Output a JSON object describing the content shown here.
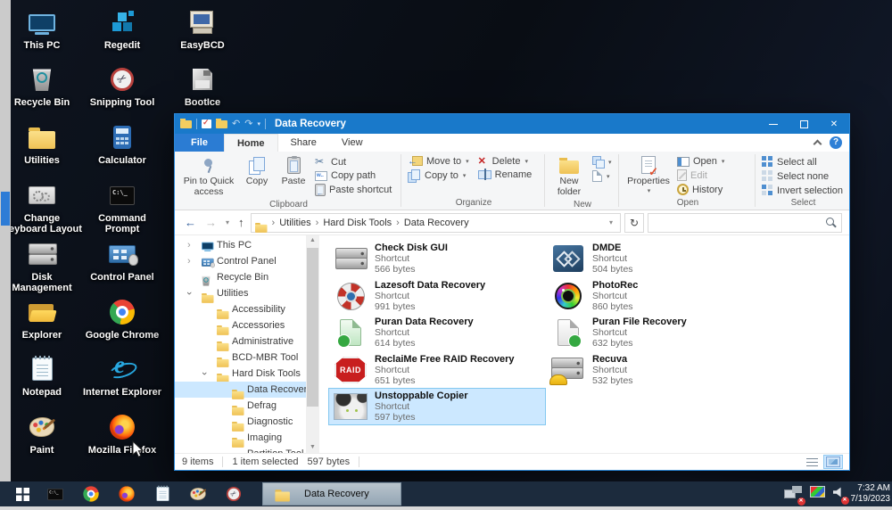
{
  "desktop": {
    "icons": [
      {
        "label": "This PC",
        "icon": "pc",
        "col": 0,
        "row": 0
      },
      {
        "label": "Regedit",
        "icon": "regedit",
        "col": 1,
        "row": 0
      },
      {
        "label": "EasyBCD",
        "icon": "easybcd",
        "col": 2,
        "row": 0
      },
      {
        "label": "Recycle Bin",
        "icon": "bin",
        "col": 0,
        "row": 1
      },
      {
        "label": "Snipping Tool",
        "icon": "snip",
        "col": 1,
        "row": 1
      },
      {
        "label": "BootIce",
        "icon": "bootice",
        "col": 2,
        "row": 1
      },
      {
        "label": "Utilities",
        "icon": "folder",
        "col": 0,
        "row": 2
      },
      {
        "label": "Calculator",
        "icon": "calc",
        "col": 1,
        "row": 2
      },
      {
        "label": "Change Keyboard Layout",
        "icon": "kbd",
        "col": 0,
        "row": 3
      },
      {
        "label": "Command Prompt",
        "icon": "cmd",
        "col": 1,
        "row": 3
      },
      {
        "label": "Disk Management",
        "icon": "hdd",
        "col": 0,
        "row": 4
      },
      {
        "label": "Control Panel",
        "icon": "cpanel",
        "col": 1,
        "row": 4
      },
      {
        "label": "Explorer",
        "icon": "explorer",
        "col": 0,
        "row": 5
      },
      {
        "label": "Google Chrome",
        "icon": "chrome",
        "col": 1,
        "row": 5
      },
      {
        "label": "Notepad",
        "icon": "notepad",
        "col": 0,
        "row": 6
      },
      {
        "label": "Internet Explorer",
        "icon": "ie",
        "col": 1,
        "row": 6
      },
      {
        "label": "Paint",
        "icon": "paint",
        "col": 0,
        "row": 7
      },
      {
        "label": "Mozilla Firefox",
        "icon": "firefox",
        "col": 1,
        "row": 7
      }
    ]
  },
  "window": {
    "title": "Data Recovery",
    "tabs": {
      "file": "File",
      "home": "Home",
      "share": "Share",
      "view": "View"
    },
    "ribbon": {
      "groups": {
        "clipboard": "Clipboard",
        "organize": "Organize",
        "new_group": "New",
        "open": "Open",
        "select": "Select"
      },
      "pin": "Pin to Quick access",
      "copy": "Copy",
      "paste": "Paste",
      "cut": "Cut",
      "copy_path": "Copy path",
      "paste_shortcut": "Paste shortcut",
      "move_to": "Move to",
      "copy_to": "Copy to",
      "delete": "Delete",
      "rename": "Rename",
      "new_folder": "New folder",
      "properties": "Properties",
      "open_item": "Open",
      "edit": "Edit",
      "history": "History",
      "select_all": "Select all",
      "select_none": "Select none",
      "invert_selection": "Invert selection"
    },
    "address": {
      "crumbs": [
        "Utilities",
        "Hard Disk Tools",
        "Data Recovery"
      ],
      "search_value": ""
    },
    "tree": {
      "items": [
        {
          "label": "This PC",
          "depth": 0,
          "icon": "pc",
          "expander": "collapsed",
          "selected": false
        },
        {
          "label": "Control Panel",
          "depth": 0,
          "icon": "cpanel",
          "expander": "collapsed",
          "selected": false
        },
        {
          "label": "Recycle Bin",
          "depth": 0,
          "icon": "bin",
          "expander": "none",
          "selected": false
        },
        {
          "label": "Utilities",
          "depth": 0,
          "icon": "folder",
          "expander": "expanded",
          "selected": false
        },
        {
          "label": "Accessibility",
          "depth": 1,
          "icon": "folder",
          "expander": "none",
          "selected": false
        },
        {
          "label": "Accessories",
          "depth": 1,
          "icon": "folder",
          "expander": "none",
          "selected": false
        },
        {
          "label": "Administrative",
          "depth": 1,
          "icon": "folder",
          "expander": "none",
          "selected": false
        },
        {
          "label": "BCD-MBR Tool",
          "depth": 1,
          "icon": "folder",
          "expander": "none",
          "selected": false
        },
        {
          "label": "Hard Disk Tools",
          "depth": 1,
          "icon": "folder",
          "expander": "expanded",
          "selected": false
        },
        {
          "label": "Data Recovery",
          "depth": 2,
          "icon": "folder",
          "expander": "none",
          "selected": true
        },
        {
          "label": "Defrag",
          "depth": 2,
          "icon": "folder",
          "expander": "none",
          "selected": false
        },
        {
          "label": "Diagnostic",
          "depth": 2,
          "icon": "folder",
          "expander": "none",
          "selected": false
        },
        {
          "label": "Imaging",
          "depth": 2,
          "icon": "folder",
          "expander": "none",
          "selected": false
        },
        {
          "label": "Partition Tool",
          "depth": 2,
          "icon": "folder",
          "expander": "none",
          "selected": false
        }
      ]
    },
    "files": {
      "columns": [
        [
          {
            "name": "Check Disk GUI",
            "type": "Shortcut",
            "size": "566 bytes",
            "icon": "chk",
            "selected": false
          },
          {
            "name": "Lazesoft Data Recovery",
            "type": "Shortcut",
            "size": "991 bytes",
            "icon": "laze",
            "selected": false
          },
          {
            "name": "Puran Data Recovery",
            "type": "Shortcut",
            "size": "614 bytes",
            "icon": "pdoc",
            "selected": false
          },
          {
            "name": "ReclaiMe Free RAID Recovery",
            "type": "Shortcut",
            "size": "651 bytes",
            "icon": "raid",
            "icon_text": "RAID",
            "selected": false
          },
          {
            "name": "Unstoppable Copier",
            "type": "Shortcut",
            "size": "597 bytes",
            "icon": "cat",
            "selected": true
          }
        ],
        [
          {
            "name": "DMDE",
            "type": "Shortcut",
            "size": "504 bytes",
            "icon": "dmde",
            "selected": false
          },
          {
            "name": "PhotoRec",
            "type": "Shortcut",
            "size": "860 bytes",
            "icon": "photorec",
            "selected": false
          },
          {
            "name": "Puran File Recovery",
            "type": "Shortcut",
            "size": "632 bytes",
            "icon": "pfile",
            "selected": false
          },
          {
            "name": "Recuva",
            "type": "Shortcut",
            "size": "532 bytes",
            "icon": "recuva",
            "selected": false
          }
        ]
      ]
    },
    "status": {
      "items": "9 items",
      "selected": "1 item selected",
      "size": "597 bytes"
    }
  },
  "taskbar": {
    "buttons": [
      "cmd",
      "chrome",
      "firefox",
      "notepad",
      "paint",
      "snip"
    ],
    "task_label": "Data Recovery",
    "tray": [
      "network",
      "display",
      "volume"
    ],
    "clock": {
      "time": "7:32 AM",
      "date": "7/19/2023"
    }
  }
}
